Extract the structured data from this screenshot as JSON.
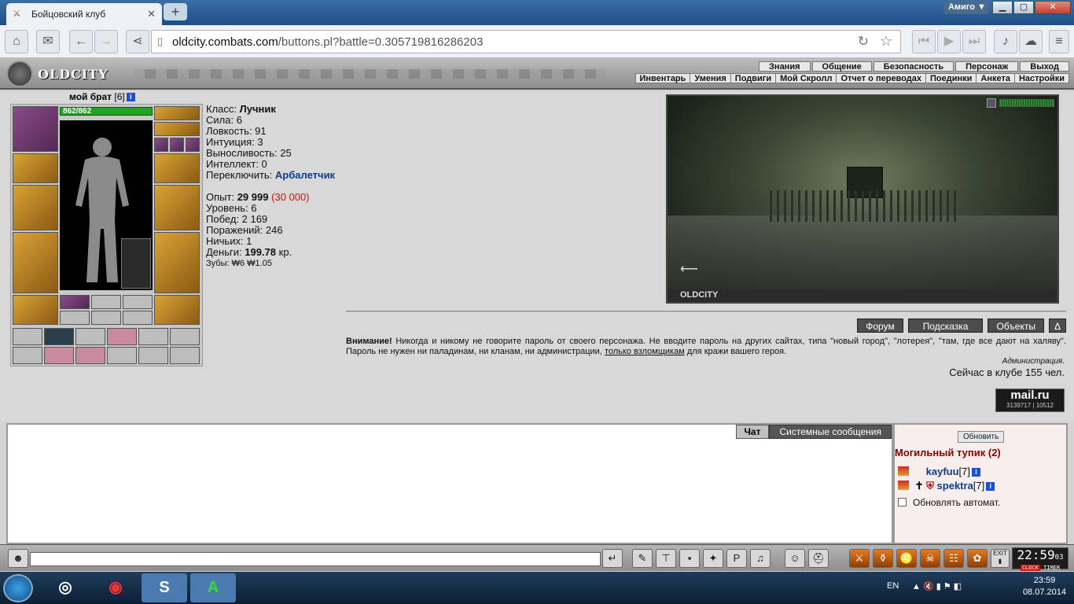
{
  "browser": {
    "tab_title": "Бойцовский клуб",
    "tab_close": "✕",
    "new_tab": "+",
    "user_badge": "Амиго ▼",
    "url_domain": "oldcity.combats.com",
    "url_path": "/buttons.pl?battle=0.305719816286203"
  },
  "header": {
    "logo": "OLDCITY",
    "menu_top": [
      "Знания",
      "Общение",
      "Безопасность",
      "Персонаж",
      "Выход"
    ],
    "menu_bottom": [
      "Инвентарь",
      "Умения",
      "Подвиги",
      "Мой Скролл",
      "Отчет о переводах",
      "Поединки",
      "Анкета",
      "Настройки"
    ]
  },
  "character": {
    "name": "мой брат",
    "level": "[6]",
    "hp": "862/862",
    "stats": {
      "class_label": "Класс:",
      "class_value": "Лучник",
      "str": "Сила: 6",
      "agi": "Ловкость: 91",
      "int": "Интуиция: 3",
      "end": "Выносливость: 25",
      "intel": "Интеллект: 0",
      "switch_label": "Переключить:",
      "switch_value": "Арбалетчик",
      "exp_label": "Опыт:",
      "exp_value": "29 999",
      "exp_next": "(30 000)",
      "level": "Уровень: 6",
      "wins": "Побед: 2 169",
      "losses": "Поражений: 246",
      "draws": "Ничьих: 1",
      "money_label": "Деньги:",
      "money_value": "199.78",
      "money_unit": "кр.",
      "teeth": "Зубы: ₩6 ₩1.05"
    }
  },
  "scene": {
    "label": "OLDCITY"
  },
  "actions": [
    "Форум",
    "Подсказка",
    "Объекты",
    "Δ"
  ],
  "warning": {
    "bold": "Внимание!",
    "text1": "Никогда и никому не говорите пароль от своего персонажа. Не вводите пароль на других сайтах, типа \"новый город\", \"лотерея\", \"там, где все дают на халяву\". Пароль не нужен ни паладинам, ни кланам, ни администрации,",
    "link": "только взломщикам",
    "text2": "для кражи вашего героя.",
    "sign": "Администрация.",
    "online": "Сейчас в клубе 155 чел."
  },
  "mailru": {
    "brand": "mail.ru",
    "count1": "3139717",
    "count2": "10512"
  },
  "chat": {
    "tab_chat": "Чат",
    "tab_system": "Системные сообщения"
  },
  "userlist": {
    "refresh": "Обновить",
    "room": "Могильный тупик (2)",
    "users": [
      {
        "name": "kayfuu",
        "level": "[7]"
      },
      {
        "name": "spektra",
        "level": "[7]"
      }
    ],
    "auto_refresh": "Обновлять автомат."
  },
  "clock": {
    "time": "22:59",
    "seconds": "03",
    "clock_label": "CLOCK",
    "timer_label": "TIMER",
    "exit_label": "EXIT"
  },
  "taskbar": {
    "lang": "EN",
    "time": "23:59",
    "date": "08.07.2014"
  }
}
